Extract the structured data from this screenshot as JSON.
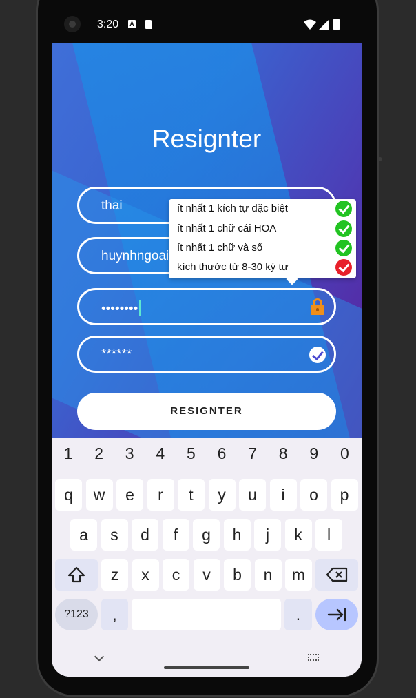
{
  "status": {
    "time": "3:20",
    "a_badge": "A"
  },
  "app": {
    "title": "Resignter",
    "fields": {
      "username": "thai",
      "email": "huynhngoai",
      "password": "••••••••",
      "confirm": "******"
    },
    "button_label": "RESIGNTER"
  },
  "password_rules": [
    {
      "text": "ít nhất 1 kích tự đặc biệt",
      "status": "ok",
      "color": "#22c322"
    },
    {
      "text": "ít nhất 1 chữ cái HOA",
      "status": "ok",
      "color": "#22c322"
    },
    {
      "text": "ít nhất 1 chữ và số",
      "status": "ok",
      "color": "#22c322"
    },
    {
      "text": "kích thước từ 8-30 ký tự",
      "status": "fail",
      "color": "#e8202a"
    }
  ],
  "keyboard": {
    "numbers": [
      "1",
      "2",
      "3",
      "4",
      "5",
      "6",
      "7",
      "8",
      "9",
      "0"
    ],
    "row1": [
      "q",
      "w",
      "e",
      "r",
      "t",
      "y",
      "u",
      "i",
      "o",
      "p"
    ],
    "row2": [
      "a",
      "s",
      "d",
      "f",
      "g",
      "h",
      "j",
      "k",
      "l"
    ],
    "row3": [
      "z",
      "x",
      "c",
      "v",
      "b",
      "n",
      "m"
    ],
    "sym_label": "?123",
    "comma": ",",
    "period": "."
  },
  "icons": {
    "lock": "lock-icon",
    "confirm_check": "check-circle-icon",
    "shift": "shift-icon",
    "backspace": "backspace-icon",
    "enter": "tab-arrow-icon"
  }
}
